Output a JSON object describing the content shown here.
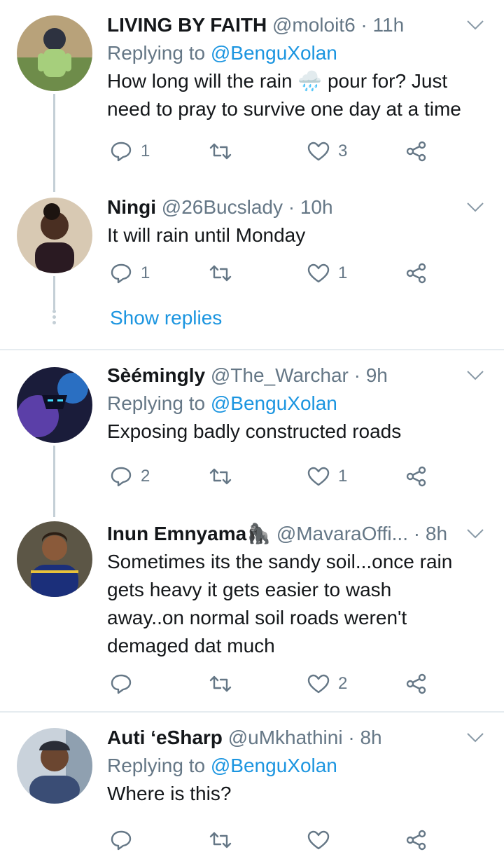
{
  "tweets": [
    {
      "name": "LIVING BY FAITH",
      "handle": "@moloit6",
      "time": "11h",
      "replying_label": "Replying to",
      "replying_to": "@BenguXolan",
      "text_lines": [
        "How long will the rain 🌧️ pour for? Just",
        "need to pray to survive one day at a time"
      ],
      "replies": "1",
      "retweets": "",
      "likes": "3"
    },
    {
      "name": "Ningi",
      "handle": "@26Bucslady",
      "time": "10h",
      "text_lines": [
        "It will rain until Monday"
      ],
      "replies": "1",
      "retweets": "",
      "likes": "1",
      "show_replies": "Show replies"
    },
    {
      "name": "Sèémingly",
      "handle": "@The_Warchar",
      "time": "9h",
      "replying_label": "Replying to",
      "replying_to": "@BenguXolan",
      "text_lines": [
        "Exposing badly constructed roads"
      ],
      "replies": "2",
      "retweets": "",
      "likes": "1"
    },
    {
      "name": "Inun Emnyama🦍",
      "handle": "@MavaraOffi...",
      "time": "8h",
      "text_lines": [
        "Sometimes its the sandy soil...once rain",
        "gets heavy it gets easier to wash",
        "away..on normal soil roads weren't",
        "demaged dat much"
      ],
      "replies": "",
      "retweets": "",
      "likes": "2"
    },
    {
      "name": "Auti ‘eSharp",
      "handle": "@uMkhathini",
      "time": "8h",
      "replying_label": "Replying to",
      "replying_to": "@BenguXolan",
      "text_lines": [
        "Where is this?"
      ],
      "replies": "",
      "retweets": "",
      "likes": ""
    }
  ],
  "separator": "·",
  "colors": {
    "secondary": "#657786",
    "link": "#1b95e0",
    "line": "#c4cfd6",
    "divider": "#e6ecf0"
  },
  "icons": [
    "reply-icon",
    "retweet-icon",
    "like-icon",
    "share-icon",
    "chevron-down-icon"
  ]
}
